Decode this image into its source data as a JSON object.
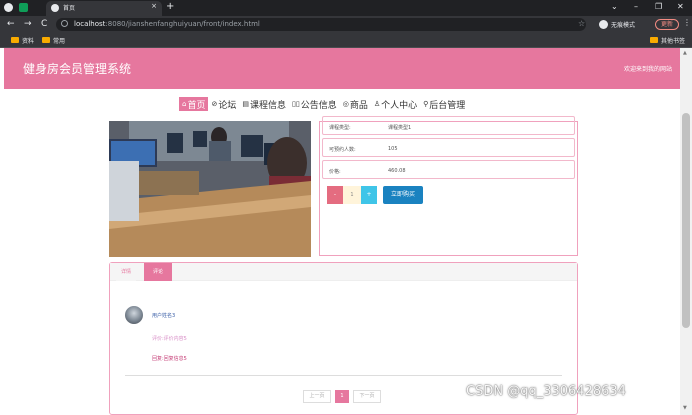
{
  "browser": {
    "tab_title": "首页",
    "tab_close": "×",
    "new_tab": "+",
    "window_controls": [
      "⌄",
      "–",
      "❐",
      "✕"
    ],
    "nav_buttons": [
      "←",
      "→",
      "C"
    ],
    "url_host": "localhost",
    "url_path": ":8080/jianshenfanghuiyuan/front/index.html",
    "star": "☆",
    "incognito_label": "无痕模式",
    "update_label": "更新",
    "menu": "⋮",
    "bookmarks": [
      "资料",
      "常用"
    ],
    "other_bookmarks": "其他书签"
  },
  "header": {
    "site_title": "健身房会员管理系统",
    "welcome": "欢迎来到我的网站"
  },
  "nav": {
    "items": [
      {
        "icon": "⌂",
        "label": "首页"
      },
      {
        "icon": "⊘",
        "label": "论坛"
      },
      {
        "icon": "▤",
        "label": "课程信息"
      },
      {
        "icon": "▯▯",
        "label": "公告信息"
      },
      {
        "icon": "◎",
        "label": "商品"
      },
      {
        "icon": "♙",
        "label": "个人中心"
      },
      {
        "icon": "⚲",
        "label": "后台管理"
      }
    ]
  },
  "details": {
    "rows": [
      {
        "key": "课程类型:",
        "value": "课程类型1"
      },
      {
        "key": "可预约人数:",
        "value": "105"
      },
      {
        "key": "价格:",
        "value": "460.08"
      }
    ],
    "stepper": {
      "minus": "-",
      "value": "1",
      "plus": "+"
    },
    "buy_button": "立即购买"
  },
  "tabs": {
    "items": [
      "详情",
      "评论"
    ],
    "active": "评论"
  },
  "comment": {
    "user": "用户姓名3",
    "content": "评价:评价内容5",
    "reply": "回复:回复信息5"
  },
  "pager": {
    "prev": "上一页",
    "current": "1",
    "next": "下一页"
  },
  "watermark": "CSDN @qq_3306428634",
  "colors": {
    "brand_pink": "#e6779e",
    "buy_blue": "#1a82c0",
    "stepper_minus": "#e46c80",
    "stepper_plus": "#3fc5e8"
  }
}
